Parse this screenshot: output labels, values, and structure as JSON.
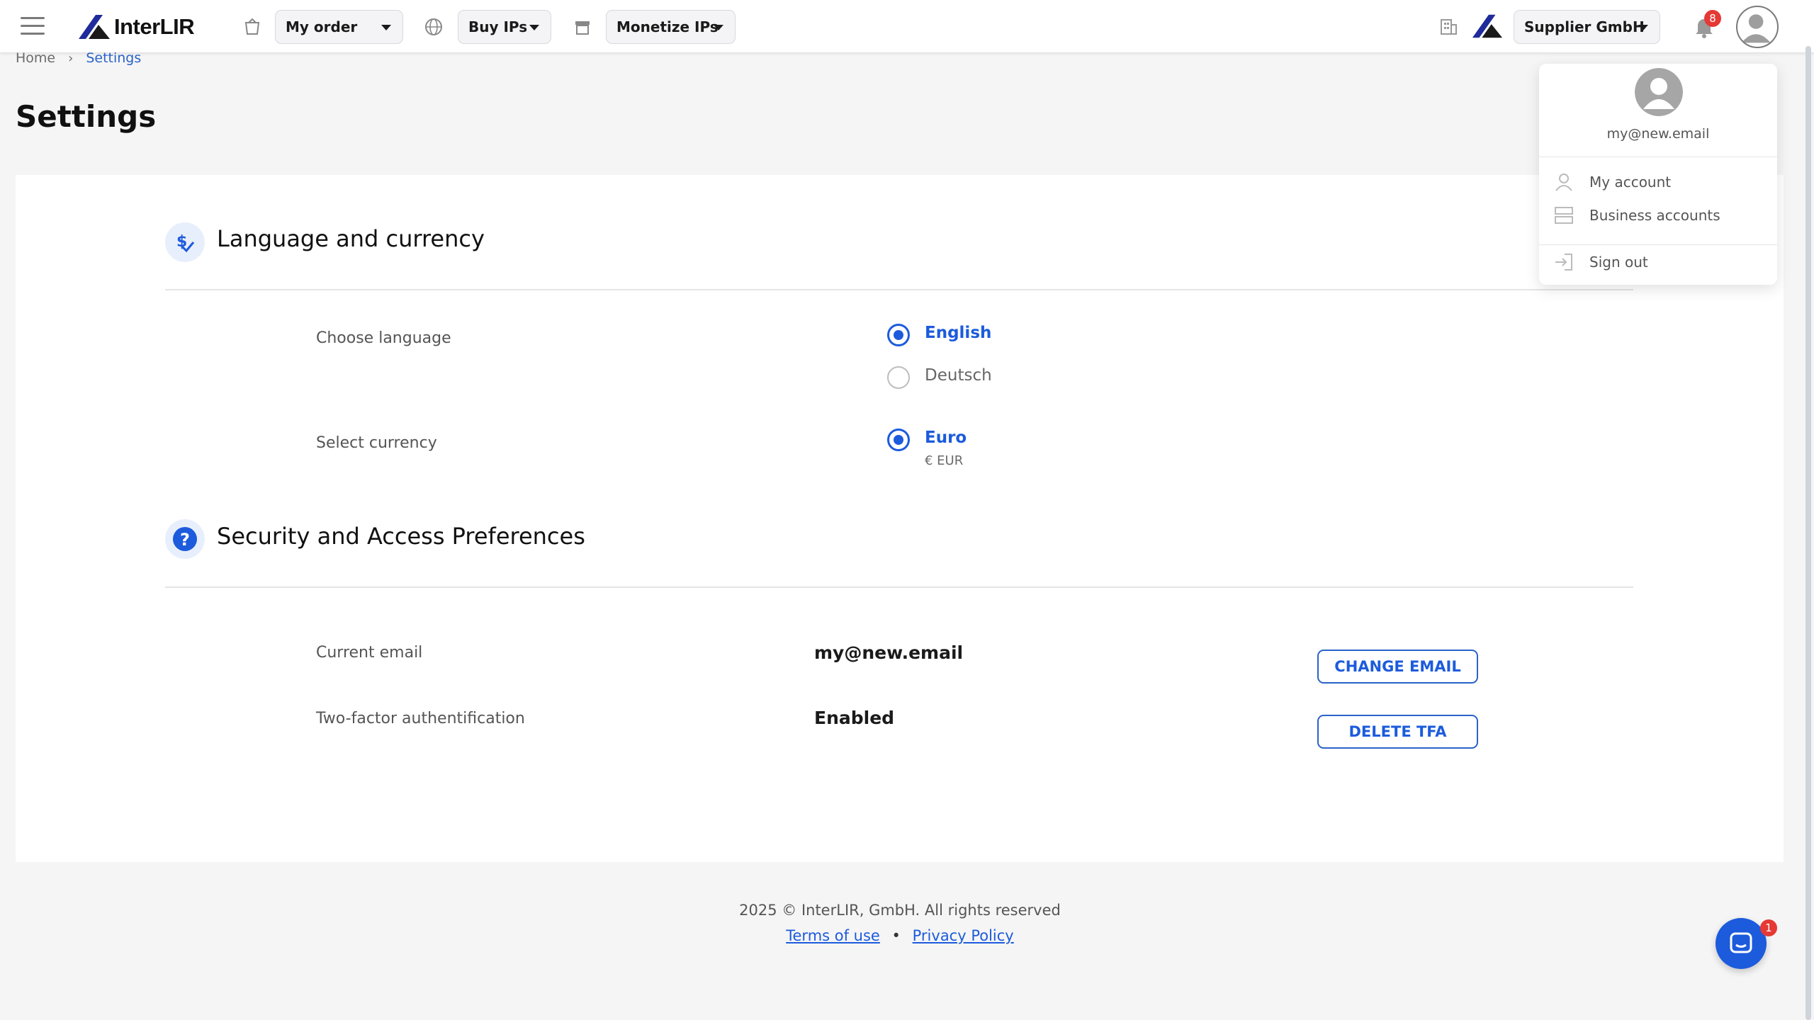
{
  "header": {
    "logo_text": "InterLIR",
    "nav": [
      {
        "label": "My order",
        "icon": "basket-icon"
      },
      {
        "label": "Buy IPs",
        "icon": "globe-icon"
      },
      {
        "label": "Monetize IPs",
        "icon": "store-icon"
      }
    ],
    "company": {
      "label": "Supplier GmbH",
      "icon": "building-icon"
    },
    "notifications_count": "8"
  },
  "breadcrumb": {
    "home": "Home",
    "current": "Settings"
  },
  "page_title": "Settings",
  "language_currency": {
    "title": "Language and currency",
    "language_label": "Choose language",
    "languages": [
      {
        "label": "English",
        "selected": true
      },
      {
        "label": "Deutsch",
        "selected": false
      }
    ],
    "currency_label": "Select currency",
    "currency": {
      "label": "Euro",
      "sub": "€ EUR",
      "selected": true
    }
  },
  "security": {
    "title": "Security and Access Preferences",
    "email_label": "Current email",
    "email_value": "my@new.email",
    "change_email_button": "CHANGE EMAIL",
    "tfa_label": "Two-factor authentification",
    "tfa_value": "Enabled",
    "delete_tfa_button": "DELETE TFA"
  },
  "user_menu": {
    "email": "my@new.email",
    "items": [
      {
        "label": "My account",
        "icon": "person-icon"
      },
      {
        "label": "Business accounts",
        "icon": "server-icon"
      },
      {
        "label": "Sign out",
        "icon": "sign-out-icon"
      }
    ]
  },
  "footer": {
    "copyright": "2025 © InterLIR, GmbH. All rights reserved",
    "terms": "Terms of use",
    "separator": "•",
    "privacy": "Privacy Policy"
  },
  "chat_badge": "1",
  "colors": {
    "accent": "#1c5bdc",
    "badge": "#e53935"
  }
}
